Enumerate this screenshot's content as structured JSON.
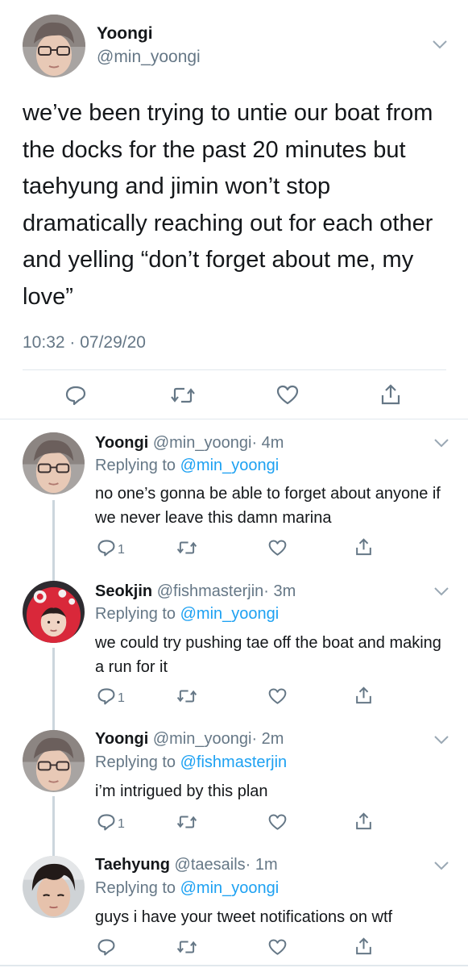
{
  "colors": {
    "text": "#14171a",
    "secondary": "#657786",
    "link": "#1da1f2",
    "divider": "#e1e8ed",
    "thread_line": "#ccd6dd"
  },
  "main_tweet": {
    "name": "Yoongi",
    "handle": "@min_yoongi",
    "text": "we’ve been trying to untie our boat from the docks for the past 20 minutes but taehyung and jimin won’t stop dramatically reaching out for each other and yelling “don’t forget about me, my love”",
    "timestamp": "10:32 · 07/29/20",
    "actions": [
      "reply-icon",
      "retweet-icon",
      "like-icon",
      "share-icon"
    ]
  },
  "replies": [
    {
      "name": "Yoongi",
      "handle": "@min_yoongi",
      "time": "· 4m",
      "replying_prefix": "Replying to",
      "replying_to": "@min_yoongi",
      "text": "no one’s gonna be able to forget about anyone if we never leave this damn marina",
      "reply_count": "1"
    },
    {
      "name": "Seokjin",
      "handle": "@fishmasterjin",
      "time": "· 3m",
      "replying_prefix": "Replying to",
      "replying_to": "@min_yoongi",
      "text": "we could try pushing tae off the boat and making a run for it",
      "reply_count": "1"
    },
    {
      "name": "Yoongi",
      "handle": "@min_yoongi",
      "time": "· 2m",
      "replying_prefix": "Replying to",
      "replying_to": "@fishmasterjin",
      "text": "i’m intrigued by this plan",
      "reply_count": "1"
    },
    {
      "name": "Taehyung",
      "handle": "@taesails",
      "time": "· 1m",
      "replying_prefix": "Replying to",
      "replying_to": "@min_yoongi",
      "text": "guys i have your tweet notifications on wtf",
      "reply_count": ""
    }
  ]
}
